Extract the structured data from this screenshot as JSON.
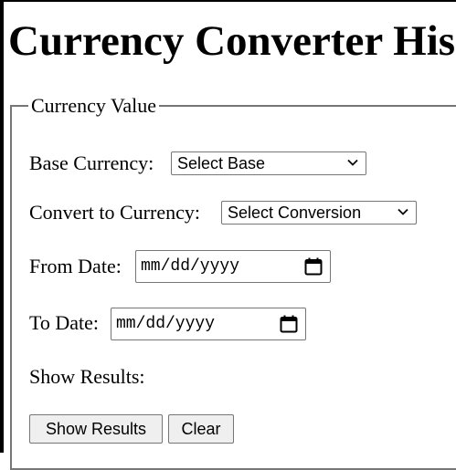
{
  "page": {
    "title": "Currency Converter His"
  },
  "form": {
    "legend": "Currency Value",
    "base_currency": {
      "label": "Base Currency:",
      "selected": "Select Base"
    },
    "convert_currency": {
      "label": "Convert to Currency:",
      "selected": "Select Conversion"
    },
    "from_date": {
      "label": "From Date:",
      "placeholder": "mm/dd/yyyy"
    },
    "to_date": {
      "label": "To Date:",
      "placeholder": "mm/dd/yyyy"
    },
    "show_results_label": "Show Results:",
    "buttons": {
      "show_results": "Show Results",
      "clear": "Clear"
    }
  },
  "icons": {
    "dropdown": "chevron-down-icon",
    "date_picker": "calendar-icon"
  }
}
